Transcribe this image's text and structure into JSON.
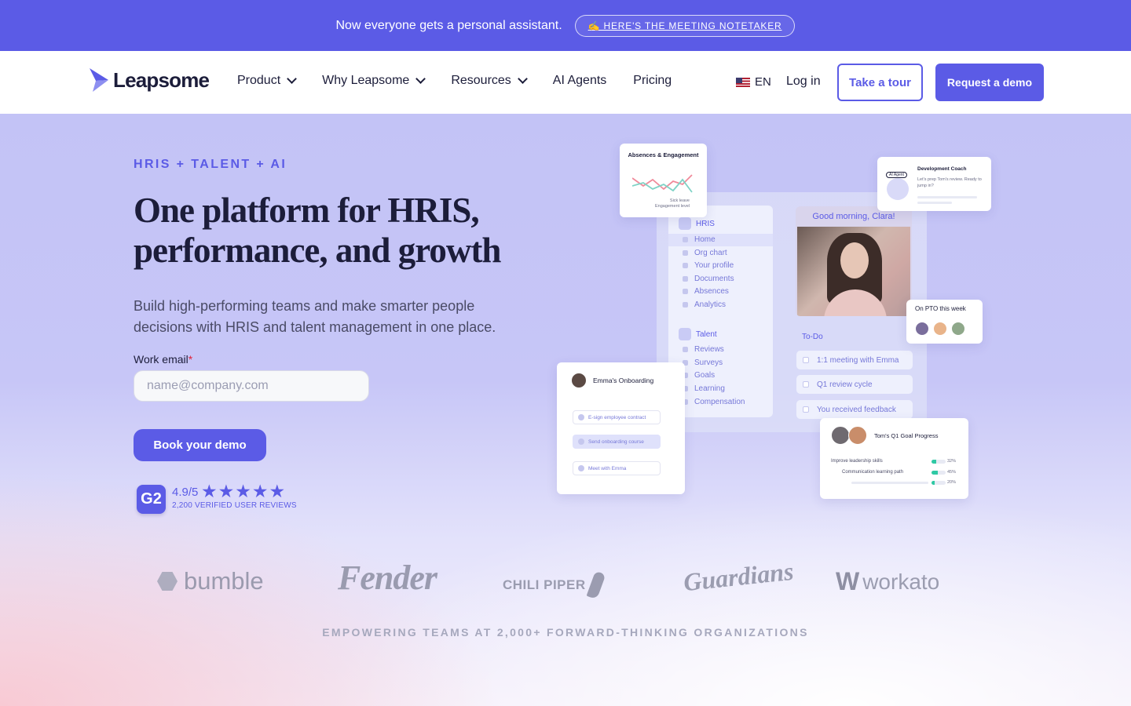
{
  "announcement": {
    "text": "Now everyone gets a personal assistant.",
    "link_label": "✍️ HERE'S THE MEETING NOTETAKER"
  },
  "nav": {
    "brand": "Leapsome",
    "links": [
      "Product",
      "Why Leapsome",
      "Resources",
      "AI Agents",
      "Pricing"
    ],
    "language": "EN",
    "login": "Log in",
    "tour_button": "Take a tour",
    "demo_button": "Request a demo"
  },
  "hero": {
    "eyebrow": "HRIS + TALENT + AI",
    "headline": "One platform for HRIS, performance, and growth",
    "subhead": "Build high-performing teams and make smarter people decisions with HRIS and talent management in one place.",
    "email_label": "Work email",
    "email_required_mark": "*",
    "email_placeholder": "name@company.com",
    "email_value": "",
    "cta": "Book your demo",
    "rating": "4.9/5",
    "stars": "★★★★★",
    "star_rating": 4.9,
    "reviews": "2,200 VERIFIED USER REVIEWS",
    "g2_badge": "G2"
  },
  "mockup": {
    "absences_title": "Absences & Engagement",
    "absences_legend": [
      "Sick leave",
      "Engagement level"
    ],
    "coach_tag": "AI Agent",
    "coach_title": "Development Coach",
    "coach_text": "Let's prep Tom's review. Ready to jump in?",
    "hris_label": "HRIS",
    "hris_items": [
      "Home",
      "Org chart",
      "Your profile",
      "Documents",
      "Absences",
      "Analytics"
    ],
    "talent_label": "Talent",
    "talent_items": [
      "Reviews",
      "Surveys",
      "Goals",
      "Learning",
      "Compensation"
    ],
    "greeting": "Good morning, Clara!",
    "pto_title": "On PTO this week",
    "todo_title": "To-Do",
    "todos": [
      "1:1 meeting with Emma",
      "Q1 review cycle",
      "You received feedback"
    ],
    "onboarding_title": "Emma's Onboarding",
    "onboarding_steps": [
      "E-sign employee contract",
      "Send onboarding course",
      "Meet with Emma"
    ],
    "goal_title": "Tom's Q1 Goal Progress",
    "goals": [
      {
        "label": "Improve leadership skills",
        "pct": "32%",
        "value": 0.32
      },
      {
        "label": "Communication learning path",
        "pct": "45%",
        "value": 0.45
      },
      {
        "label": "",
        "pct": "20%",
        "value": 0.2
      }
    ]
  },
  "logos": {
    "bumble": "bumble",
    "fender": "Fender",
    "chili_piper": "CHILI PIPER",
    "guardians": "Guardians",
    "workato": "workato"
  },
  "tagline": "EMPOWERING TEAMS AT 2,000+ FORWARD-THINKING ORGANIZATIONS",
  "colors": {
    "brand": "#5b5be6",
    "hero_bg": "#c7c6f7",
    "text_dark": "#1c1d3a"
  }
}
